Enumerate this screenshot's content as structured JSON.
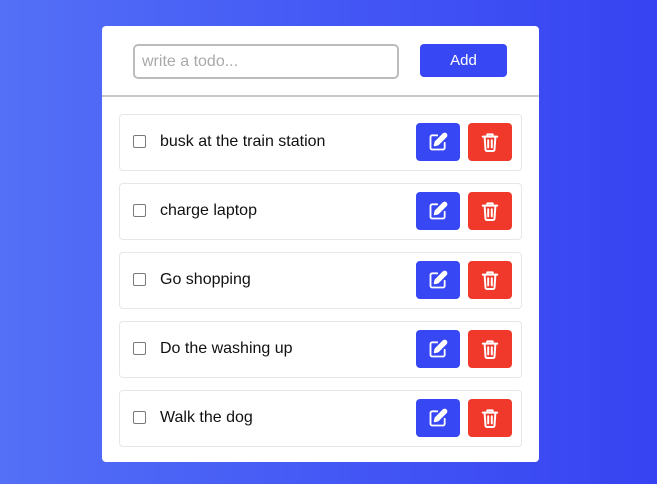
{
  "form": {
    "input_placeholder": "write a todo...",
    "input_value": "",
    "add_label": "Add"
  },
  "todos": [
    {
      "text": "busk at the train station",
      "checked": false
    },
    {
      "text": "charge laptop",
      "checked": false
    },
    {
      "text": "Go shopping",
      "checked": false
    },
    {
      "text": "Do the washing up",
      "checked": false
    },
    {
      "text": "Walk the dog",
      "checked": false
    }
  ],
  "icons": {
    "edit": "pencil-square-icon",
    "delete": "trash-icon"
  },
  "colors": {
    "background_start": "#5470f6",
    "background_end": "#3643f2",
    "accent": "#3747f4",
    "danger": "#f0392b"
  }
}
